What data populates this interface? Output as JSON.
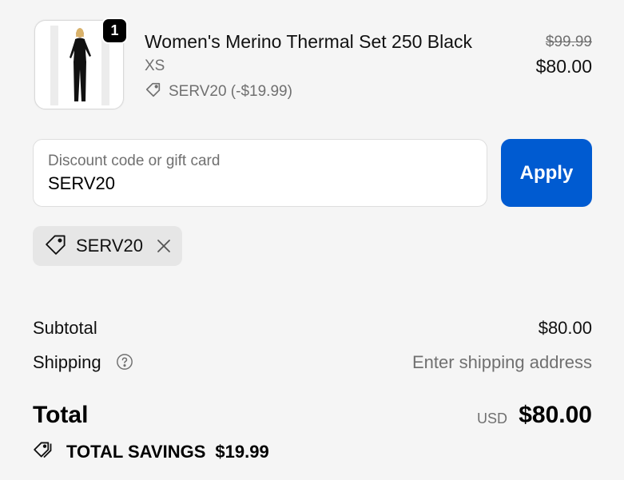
{
  "product": {
    "quantity_badge": "1",
    "name": "Women's Merino Thermal Set 250 Black",
    "variant": "XS",
    "discount_line": "SERV20 (-$19.99)",
    "price_original": "$99.99",
    "price_final": "$80.00"
  },
  "discount": {
    "field_label": "Discount code or gift card",
    "field_value": "SERV20",
    "apply_label": "Apply",
    "applied_code": "SERV20"
  },
  "summary": {
    "subtotal_label": "Subtotal",
    "subtotal_value": "$80.00",
    "shipping_label": "Shipping",
    "shipping_value": "Enter shipping address",
    "total_label": "Total",
    "total_currency": "USD",
    "total_value": "$80.00",
    "savings_label": "TOTAL SAVINGS",
    "savings_value": "$19.99"
  },
  "colors": {
    "accent": "#005bd1",
    "muted_text": "#707070",
    "background": "#f5f5f5"
  }
}
